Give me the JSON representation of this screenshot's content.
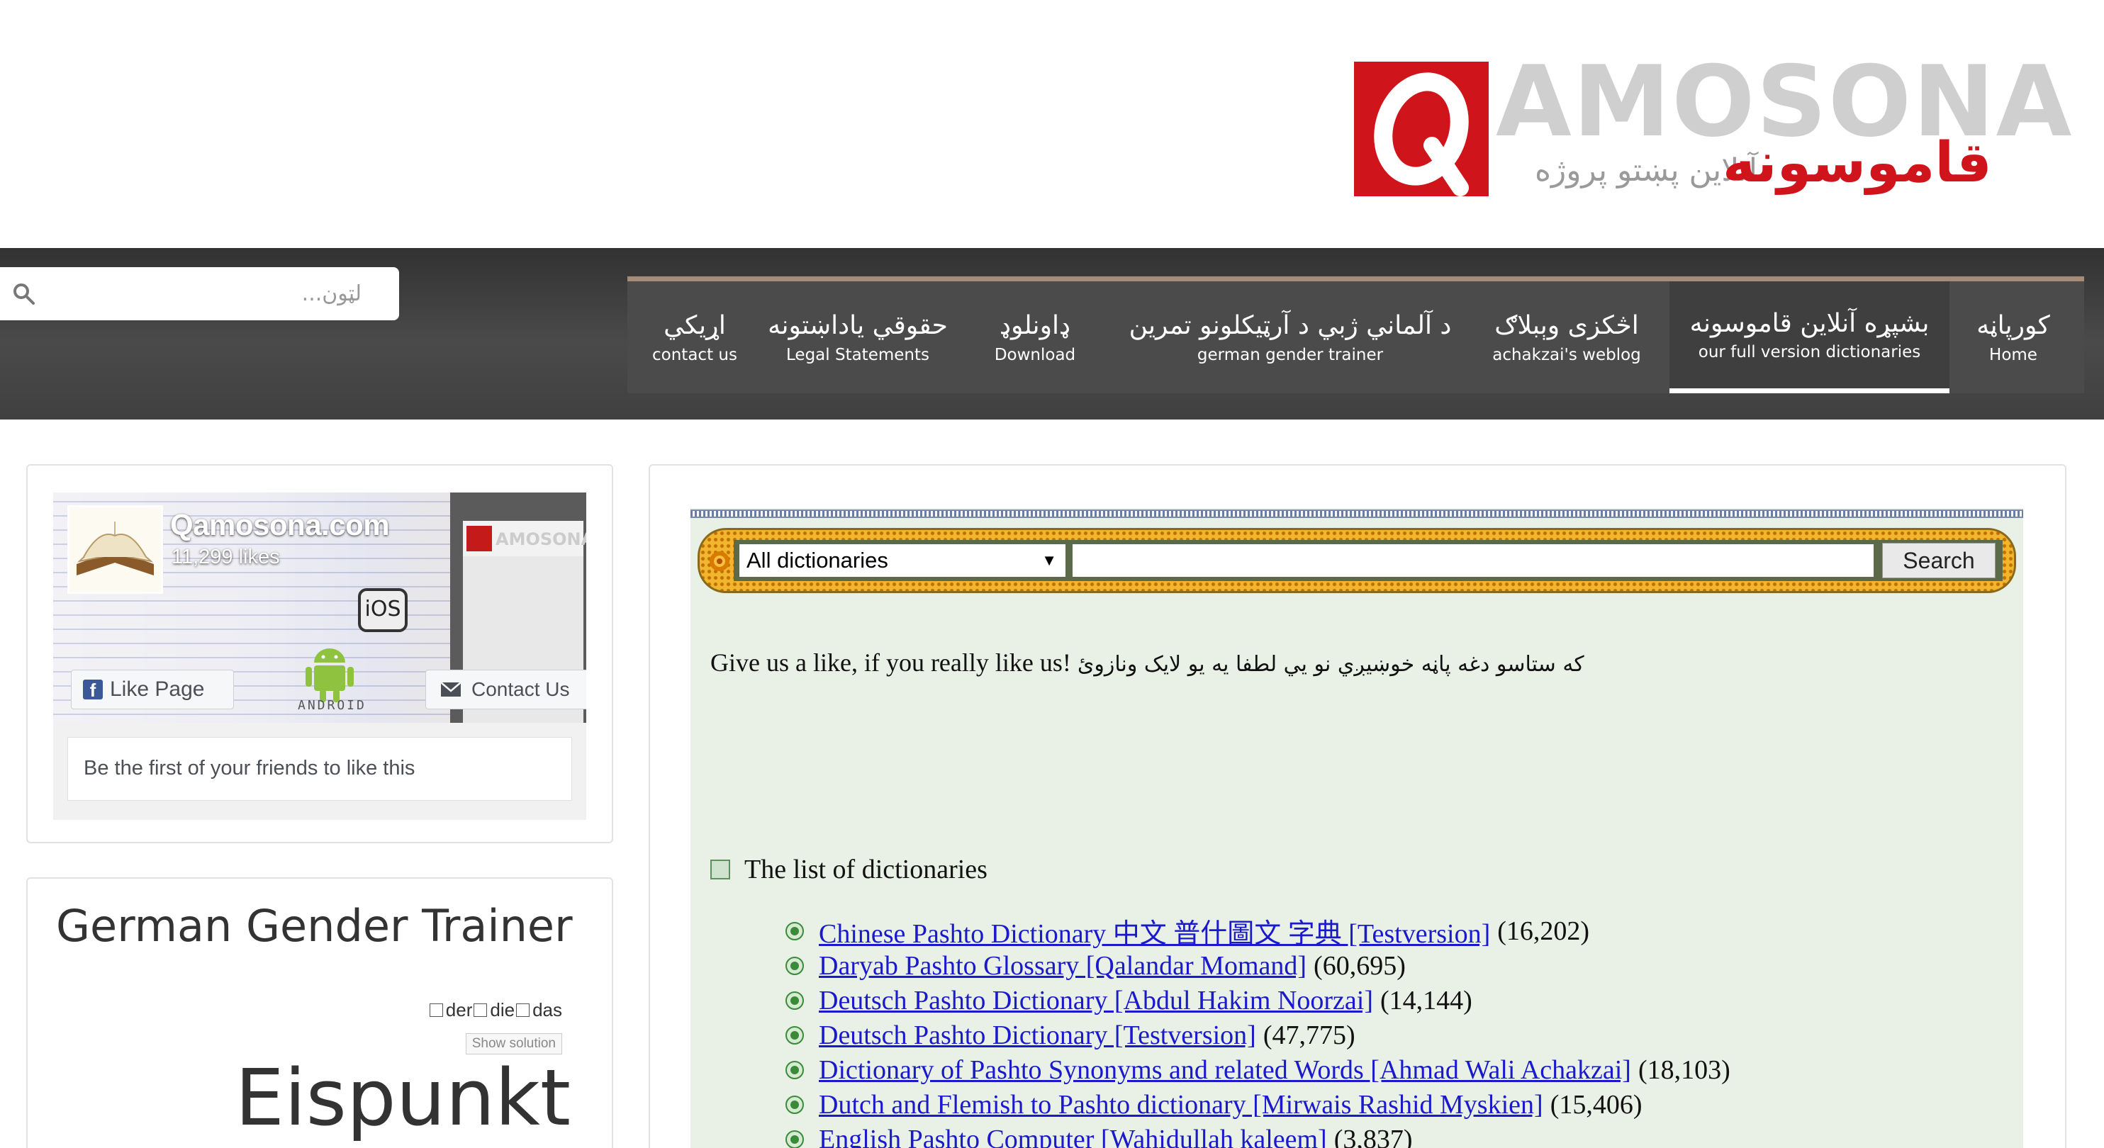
{
  "logo": {
    "q_letter": "Q",
    "latin": "AMOSONA",
    "pashto": "قاموسونه",
    "subtitle": "آنلاين پښتو پروژه"
  },
  "search": {
    "placeholder": "لټون..."
  },
  "nav": {
    "items": [
      {
        "ps": "اړيکي",
        "en": "contact us",
        "active": false
      },
      {
        "ps": "حقوقي ياداښتونه",
        "en": "Legal Statements",
        "active": false
      },
      {
        "ps": "ډاونلوډ",
        "en": "Download",
        "active": false
      },
      {
        "ps": "د آلماني ژبي د آرټيکلونو تمرين",
        "en": "german gender trainer",
        "active": false
      },
      {
        "ps": "اڅکزی وېبلاګ",
        "en": "achakzai's weblog",
        "active": false
      },
      {
        "ps": "بشپړه آنلاين قاموسونه",
        "en": "our full version dictionaries",
        "active": true
      },
      {
        "ps": "کورپاڼه",
        "en": "Home",
        "active": false
      }
    ]
  },
  "facebook": {
    "page_name": "Qamosona.com",
    "likes": "11,299 likes",
    "like_button": "Like Page",
    "contact_button": "Contact Us",
    "friends_text": "Be the first of your friends to like this",
    "ios_label": "iOS",
    "android_label": "ANDROID"
  },
  "gender_trainer": {
    "title": "German Gender Trainer",
    "options": [
      "der",
      "die",
      "das"
    ],
    "show_solution": "Show solution",
    "word": "Eispunkt"
  },
  "dictionary_search": {
    "selected": "All dictionaries",
    "button": "Search"
  },
  "main": {
    "like_en": "Give us a like, if you really like us!",
    "like_ps": "که ستاسو دغه پاڼه خوښيږي نو يي لطفا يه يو لايک ونازوئ",
    "list_heading": "The list of dictionaries",
    "dictionaries": [
      {
        "name": "Chinese Pashto Dictionary 中文 普什圖文 字典 [Testversion]",
        "count": "(16,202)"
      },
      {
        "name": "Daryab Pashto Glossary [Qalandar Momand]",
        "count": "(60,695)"
      },
      {
        "name": "Deutsch Pashto Dictionary [Abdul Hakim Noorzai]",
        "count": "(14,144)"
      },
      {
        "name": "Deutsch Pashto Dictionary [Testversion]",
        "count": "(47,775)"
      },
      {
        "name": "Dictionary of Pashto Synonyms and related Words [Ahmad Wali Achakzai]",
        "count": "(18,103)"
      },
      {
        "name": "Dutch and Flemish to Pashto dictionary [Mirwais Rashid Myskien]",
        "count": "(15,406)"
      },
      {
        "name": "English Pashto Computer [Wahidullah kaleem]",
        "count": "(3,837)"
      }
    ]
  },
  "colors": {
    "brand_red": "#d0141c",
    "nav_dark": "#404040",
    "link_blue": "#1a1acc",
    "list_bg": "#e9f1e6",
    "search_frame": "#f1b62e"
  }
}
